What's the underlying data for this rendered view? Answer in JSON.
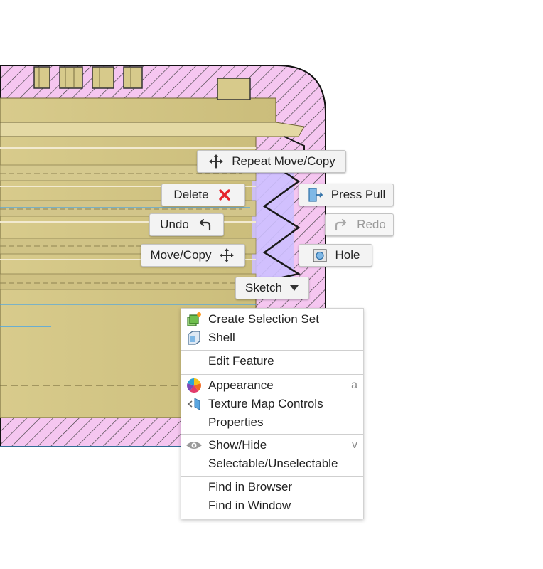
{
  "marking_menu": {
    "repeat_move_copy": "Repeat Move/Copy",
    "delete": "Delete",
    "press_pull": "Press Pull",
    "undo": "Undo",
    "redo": "Redo",
    "move_copy": "Move/Copy",
    "hole": "Hole",
    "sketch": "Sketch"
  },
  "context_menu": {
    "groups": [
      [
        {
          "label": "Create Selection Set",
          "icon": "selection-set-icon"
        },
        {
          "label": "Shell",
          "icon": "shell-icon"
        }
      ],
      [
        {
          "label": "Edit Feature",
          "icon": ""
        }
      ],
      [
        {
          "label": "Appearance",
          "icon": "appearance-icon",
          "shortcut": "a"
        },
        {
          "label": "Texture Map Controls",
          "icon": "texture-map-icon"
        },
        {
          "label": "Properties",
          "icon": ""
        }
      ],
      [
        {
          "label": "Show/Hide",
          "icon": "eye-icon",
          "shortcut": "v"
        },
        {
          "label": "Selectable/Unselectable",
          "icon": ""
        }
      ],
      [
        {
          "label": "Find in Browser",
          "icon": ""
        },
        {
          "label": "Find in Window",
          "icon": ""
        }
      ]
    ]
  },
  "colors": {
    "section_hatch_fill": "#f5c6f0",
    "section_hatch_line": "#3a3a3a",
    "part_body": "#d9cc8f",
    "part_highlight": "#cdbfff",
    "delete_red": "#e5232c"
  }
}
